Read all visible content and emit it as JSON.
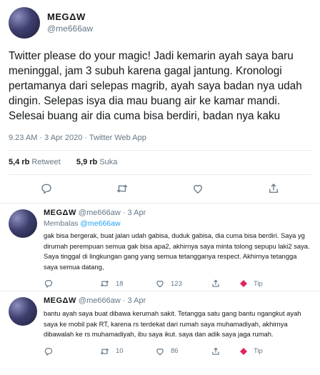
{
  "main_tweet": {
    "display_name": "MEGΔW",
    "handle": "@me666aw",
    "text": "Twitter please do your magic! Jadi kemarin ayah saya baru meninggal, jam 3 subuh karena gagal jantung. Kronologi pertamanya dari selepas magrib, ayah saya badan nya udah dingin. Selepas isya dia mau buang air ke kamar mandi. Selesai buang air dia cuma bisa berdiri, badan nya kaku",
    "time": "9.23 AM · 3 Apr 2020 · Twitter Web App",
    "retweet_count": "5,4 rb",
    "retweet_label": "Retweet",
    "like_count": "5,9 rb",
    "like_label": "Suka",
    "icons": [
      "reply-icon",
      "retweet-icon",
      "like-icon",
      "share-icon"
    ]
  },
  "replies": [
    {
      "display_name": "MEGΔW",
      "handle_time": "@me666aw · 3 Apr",
      "replying_prefix": "Membalas",
      "replying_to": "@me666aw",
      "text": "gak bisa bergerak, buat jalan udah gabisa, duduk gabisa, dia cuma bisa berdiri. Saya yg dirumah perempuan semua gak bisa apa2, akhirnya saya minta tolong sepupu laki2 saya. Saya tinggal di lingkungan gang yang semua tetangganya respect. Akhirnya tetangga saya semua datang,",
      "reply_count": "",
      "retweet_count": "18",
      "like_count": "123",
      "tip_label": "Tip"
    },
    {
      "display_name": "MEGΔW",
      "handle_time": "@me666aw · 3 Apr",
      "text": "bantu ayah saya buat dibawa kerumah sakit. Tetangga satu gang bantu ngangkut ayah saya ke mobil pak RT, karena rs terdekat dari rumah saya muhamadiyah, akhirnya dibawalah ke rs muhamadiyah, ibu saya ikut. saya dan adik saya jaga rumah.",
      "reply_count": "",
      "retweet_count": "10",
      "like_count": "86",
      "tip_label": "Tip"
    }
  ],
  "colors": {
    "accent": "#1da1f2",
    "muted": "#657786",
    "text": "#14171a",
    "divider": "#e6ecf0",
    "tip": "#e0245e"
  }
}
